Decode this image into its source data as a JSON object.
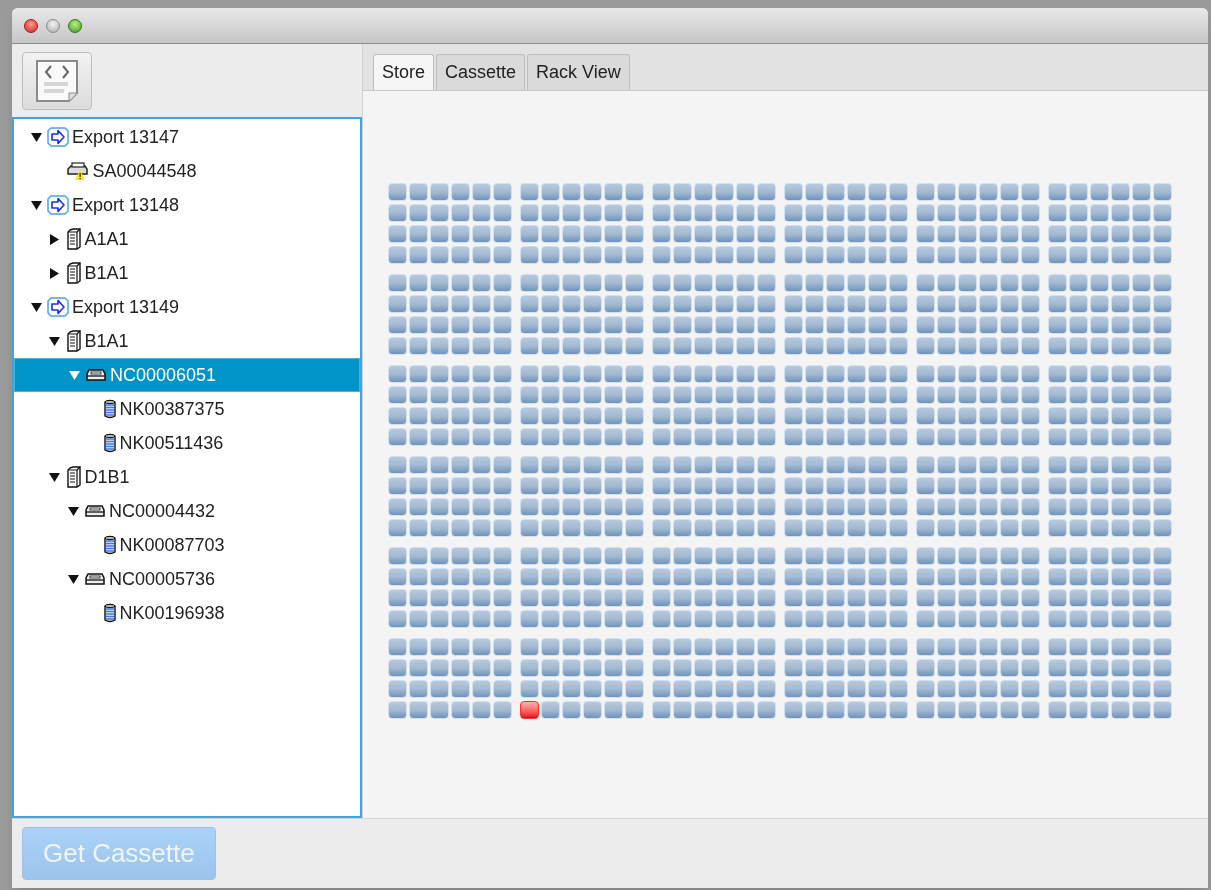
{
  "tabs": [
    {
      "label": "Store",
      "selected": true
    },
    {
      "label": "Cassette",
      "selected": false
    },
    {
      "label": "Rack View",
      "selected": false
    }
  ],
  "tree": [
    {
      "kind": "export",
      "label": "Export 13147",
      "expanded": true,
      "selected": false,
      "children": [
        {
          "kind": "sample",
          "label": "SA00044548",
          "selected": false
        }
      ]
    },
    {
      "kind": "export",
      "label": "Export 13148",
      "expanded": true,
      "selected": false,
      "children": [
        {
          "kind": "rack",
          "label": "A1A1",
          "expanded": false,
          "selected": false
        },
        {
          "kind": "rack",
          "label": "B1A1",
          "expanded": false,
          "selected": false
        }
      ]
    },
    {
      "kind": "export",
      "label": "Export 13149",
      "expanded": true,
      "selected": false,
      "children": [
        {
          "kind": "rack",
          "label": "B1A1",
          "expanded": true,
          "selected": false,
          "children": [
            {
              "kind": "cassette",
              "label": "NC00006051",
              "expanded": true,
              "selected": true,
              "children": [
                {
                  "kind": "tube",
                  "label": "NK00387375",
                  "selected": false
                },
                {
                  "kind": "tube",
                  "label": "NK00511436",
                  "selected": false
                }
              ]
            }
          ]
        },
        {
          "kind": "rack",
          "label": "D1B1",
          "expanded": true,
          "selected": false,
          "children": [
            {
              "kind": "cassette",
              "label": "NC00004432",
              "expanded": true,
              "selected": false,
              "children": [
                {
                  "kind": "tube",
                  "label": "NK00087703",
                  "selected": false
                }
              ]
            },
            {
              "kind": "cassette",
              "label": "NC00005736",
              "expanded": true,
              "selected": false,
              "children": [
                {
                  "kind": "tube",
                  "label": "NK00196938",
                  "selected": false
                }
              ]
            }
          ]
        }
      ]
    }
  ],
  "store_grid": {
    "blocks": [
      {
        "kind": "plain"
      },
      {
        "kind": "plain"
      },
      {
        "kind": "plain"
      },
      {
        "kind": "plain"
      },
      {
        "kind": "plain"
      },
      {
        "kind": "plain"
      },
      {
        "kind": "plain"
      },
      {
        "kind": "plain"
      },
      {
        "kind": "plain"
      },
      {
        "kind": "plain"
      },
      {
        "kind": "plain"
      },
      {
        "kind": "plain"
      },
      {
        "kind": "plain"
      },
      {
        "kind": "plain"
      },
      {
        "kind": "plain"
      },
      {
        "kind": "plain"
      },
      {
        "kind": "plain"
      },
      {
        "kind": "plain"
      },
      {
        "kind": "plain"
      },
      {
        "kind": "plain"
      },
      {
        "kind": "plain"
      },
      {
        "kind": "plain"
      },
      {
        "kind": "plain"
      },
      {
        "kind": "plain"
      },
      {
        "kind": "plain"
      },
      {
        "kind": "plain"
      },
      {
        "kind": "plain"
      },
      {
        "kind": "plain"
      },
      {
        "kind": "plain"
      },
      {
        "kind": "plain"
      },
      {
        "kind": "plain"
      },
      {
        "kind": "marked",
        "slots": [
          {
            "selected": false
          },
          {
            "selected": false
          },
          {
            "selected": false
          },
          {
            "selected": false
          },
          {
            "selected": false
          },
          {
            "selected": false
          },
          {
            "selected": false
          },
          {
            "selected": false
          },
          {
            "selected": false
          },
          {
            "selected": false
          },
          {
            "selected": false
          },
          {
            "selected": false
          },
          {
            "selected": false
          },
          {
            "selected": false
          },
          {
            "selected": false
          },
          {
            "selected": false
          },
          {
            "selected": false
          },
          {
            "selected": false
          },
          {
            "selected": true
          },
          {
            "selected": false
          },
          {
            "selected": false
          },
          {
            "selected": false
          },
          {
            "selected": false
          },
          {
            "selected": false
          }
        ]
      },
      {
        "kind": "plain"
      },
      {
        "kind": "plain"
      },
      {
        "kind": "plain"
      },
      {
        "kind": "plain"
      }
    ]
  },
  "buttons": [
    {
      "label": "Get Cassette",
      "disabled": true
    }
  ]
}
